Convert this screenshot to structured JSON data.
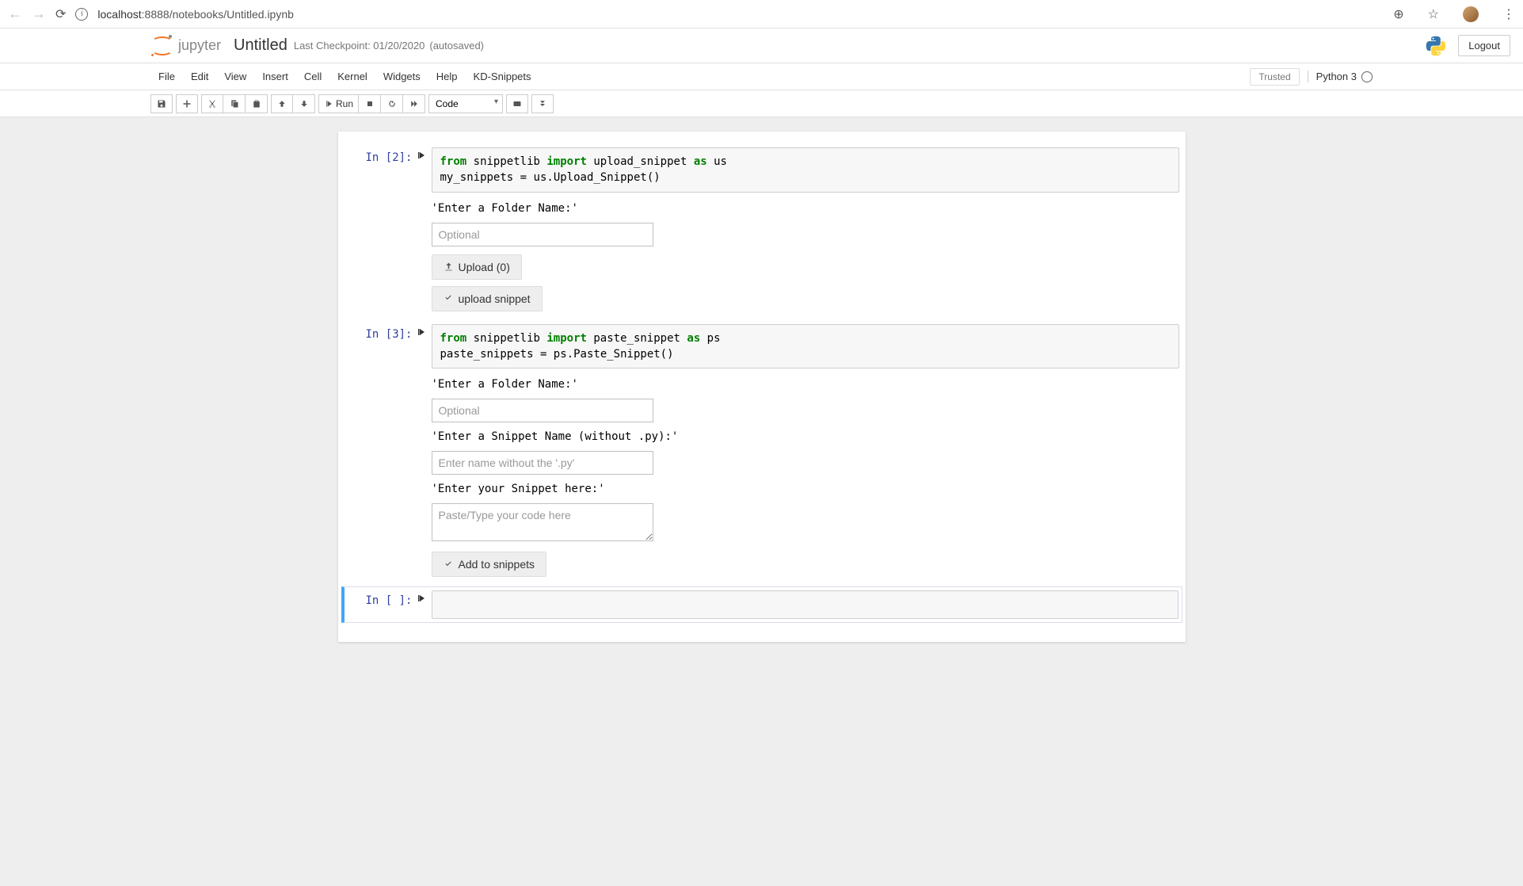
{
  "browser": {
    "url_host": "localhost",
    "url_path": ":8888/notebooks/Untitled.ipynb"
  },
  "header": {
    "logo_text": "jupyter",
    "title": "Untitled",
    "checkpoint": "Last Checkpoint: 01/20/2020",
    "autosaved": "(autosaved)",
    "logout": "Logout"
  },
  "menubar": {
    "items": [
      "File",
      "Edit",
      "View",
      "Insert",
      "Cell",
      "Kernel",
      "Widgets",
      "Help",
      "KD-Snippets"
    ],
    "trusted": "Trusted",
    "kernel": "Python 3"
  },
  "toolbar": {
    "run_label": "Run",
    "cell_type": "Code"
  },
  "cells": [
    {
      "prompt": "In [2]:",
      "code_tokens": [
        {
          "t": "from",
          "c": "kw-green"
        },
        {
          "t": " snippetlib "
        },
        {
          "t": "import",
          "c": "kw-green"
        },
        {
          "t": " upload_snippet "
        },
        {
          "t": "as",
          "c": "kw-green"
        },
        {
          "t": " us\n"
        },
        {
          "t": "my_snippets "
        },
        {
          "t": "="
        },
        {
          "t": " us"
        },
        {
          "t": "."
        },
        {
          "t": "Upload_Snippet()"
        }
      ],
      "output": {
        "folder_label": "'Enter a Folder Name:'",
        "folder_placeholder": "Optional",
        "upload_btn": "Upload (0)",
        "upload_snippet_btn": "upload snippet"
      }
    },
    {
      "prompt": "In [3]:",
      "code_tokens": [
        {
          "t": "from",
          "c": "kw-green"
        },
        {
          "t": " snippetlib "
        },
        {
          "t": "import",
          "c": "kw-green"
        },
        {
          "t": " paste_snippet "
        },
        {
          "t": "as",
          "c": "kw-green"
        },
        {
          "t": " ps\n"
        },
        {
          "t": "paste_snippets "
        },
        {
          "t": "="
        },
        {
          "t": " ps"
        },
        {
          "t": "."
        },
        {
          "t": "Paste_Snippet()"
        }
      ],
      "output": {
        "folder_label": "'Enter a Folder Name:'",
        "folder_placeholder": "Optional",
        "snippet_name_label": "'Enter a Snippet Name (without .py):'",
        "snippet_name_placeholder": "Enter name without the '.py'",
        "snippet_here_label": "'Enter your Snippet here:'",
        "snippet_here_placeholder": "Paste/Type your code here",
        "add_btn": "Add to snippets"
      }
    },
    {
      "prompt": "In [ ]:",
      "selected": true
    }
  ]
}
